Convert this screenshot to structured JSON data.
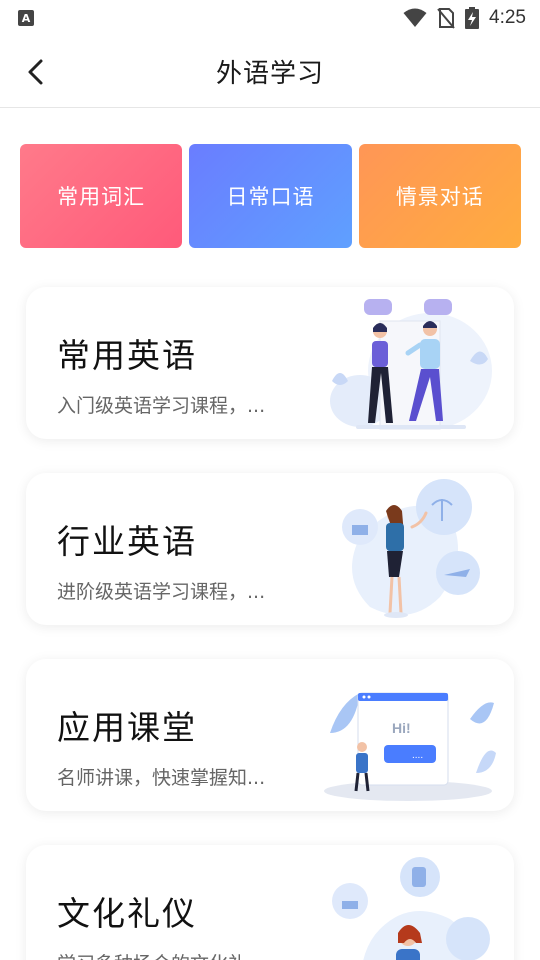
{
  "status_bar": {
    "notification_icon": "A",
    "time": "4:25",
    "icons": [
      "wifi-icon",
      "no-sim-icon",
      "battery-charging-icon"
    ]
  },
  "app_bar": {
    "title": "外语学习",
    "back_icon": "chevron-left-icon"
  },
  "categories": [
    {
      "label": "常用词汇",
      "color": "#ff6b84"
    },
    {
      "label": "日常口语",
      "color": "#5b8dff"
    },
    {
      "label": "情景对话",
      "color": "#ffa04a"
    }
  ],
  "courses": [
    {
      "title": "常用英语",
      "description": "入门级英语学习课程，..."
    },
    {
      "title": "行业英语",
      "description": "进阶级英语学习课程，..."
    },
    {
      "title": "应用课堂",
      "description": "名师讲课，快速掌握知...",
      "bubble_text": "Hi!"
    },
    {
      "title": "文化礼仪",
      "description": "学习多种场合的文化礼..."
    }
  ],
  "colors": {
    "accent_blue": "#4a7dff",
    "illustration_light": "#e8f0fc"
  }
}
